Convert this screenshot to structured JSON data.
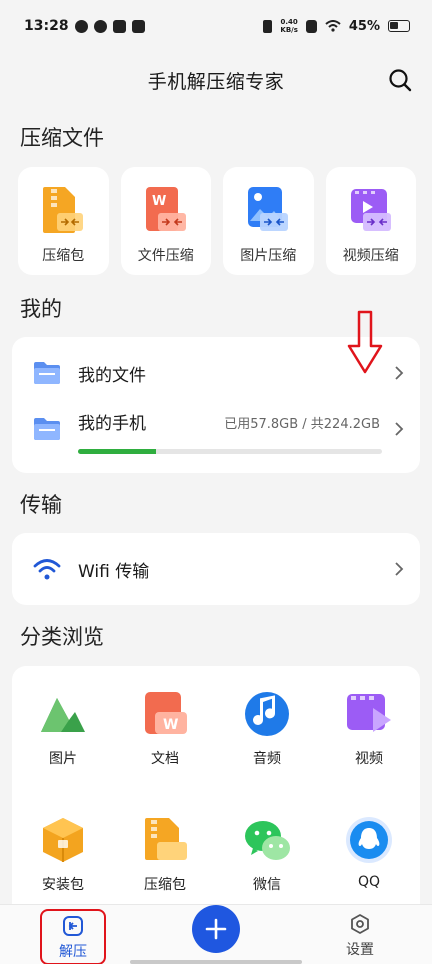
{
  "status_bar": {
    "time": "13:28",
    "speed_value": "0.40",
    "speed_unit": "KB/s",
    "battery": "45%"
  },
  "header": {
    "title": "手机解压缩专家",
    "search_icon": "search-icon"
  },
  "compress": {
    "title": "压缩文件",
    "cards": [
      {
        "label": "压缩包",
        "icon": "zip-package-icon",
        "color": "#f5a623"
      },
      {
        "label": "文件压缩",
        "icon": "word-document-icon",
        "color": "#f26b4f"
      },
      {
        "label": "图片压缩",
        "icon": "image-icon",
        "color": "#2f7df6"
      },
      {
        "label": "视频压缩",
        "icon": "video-icon",
        "color": "#9c5cf5"
      }
    ]
  },
  "mine": {
    "title": "我的",
    "items": [
      {
        "label": "我的文件",
        "icon": "folder-icon"
      },
      {
        "label": "我的手机",
        "icon": "folder-icon",
        "storage": "已用57.8GB / 共224.2GB",
        "used_fraction": 0.258
      }
    ]
  },
  "transfer": {
    "title": "传输",
    "items": [
      {
        "label": "Wifi 传输",
        "icon": "wifi-icon"
      }
    ]
  },
  "browse": {
    "title": "分类浏览",
    "items": [
      {
        "label": "图片",
        "icon": "mountain-image-icon"
      },
      {
        "label": "文档",
        "icon": "document-icon"
      },
      {
        "label": "音频",
        "icon": "music-icon"
      },
      {
        "label": "视频",
        "icon": "video-icon"
      },
      {
        "label": "安装包",
        "icon": "package-box-icon"
      },
      {
        "label": "压缩包",
        "icon": "zip-package-icon"
      },
      {
        "label": "微信",
        "icon": "wechat-icon"
      },
      {
        "label": "QQ",
        "icon": "qq-icon"
      }
    ]
  },
  "bottom_nav": {
    "tabs": [
      {
        "label": "解压",
        "icon": "unzip-icon",
        "active": true
      },
      {
        "label": "设置",
        "icon": "settings-icon",
        "active": false
      }
    ],
    "fab_icon": "plus-icon"
  },
  "colors": {
    "accent": "#1f57e0",
    "progress": "#2fae3f",
    "annotation": "#e0141b"
  }
}
